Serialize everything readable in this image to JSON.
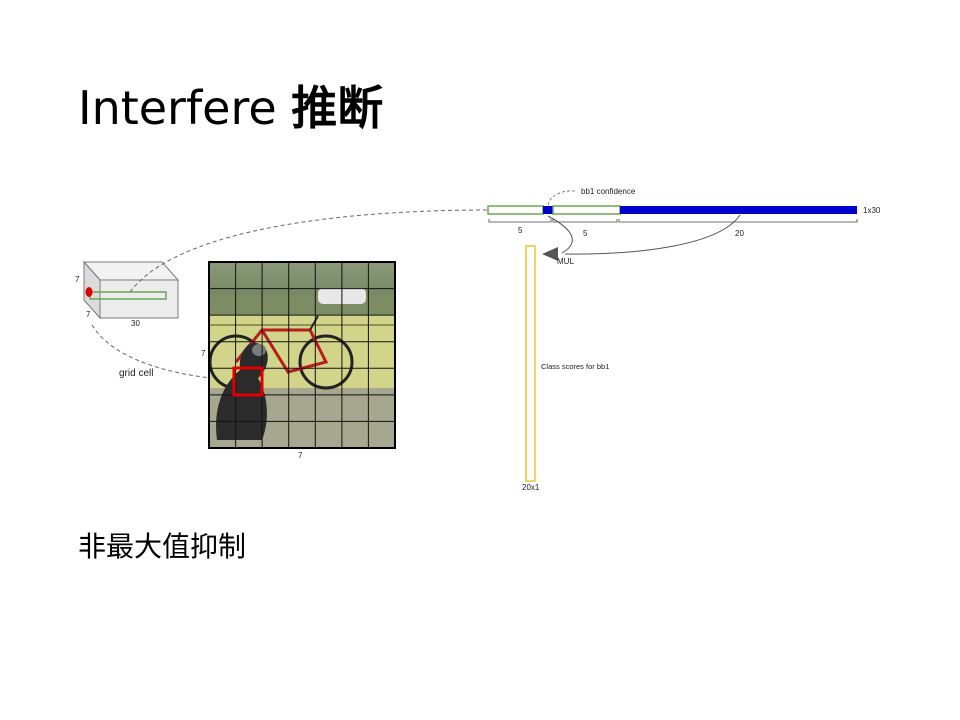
{
  "title": {
    "latin": "Interfere",
    "cjk": "推断"
  },
  "bullet": "非最大值抑制",
  "diagram": {
    "tensor_dims": {
      "height": "7",
      "width": "7",
      "depth": "30"
    },
    "grid_cell_label": "grid cell",
    "image_dims": {
      "side": "7",
      "bottom": "7"
    },
    "vector_label": "1x30",
    "segment_labels": {
      "box1": "5",
      "box2": "5",
      "classes": "20"
    },
    "confidence_label": "bb1 confidence",
    "mul_label": "MUL",
    "class_scores_label": "Class scores for bb1",
    "class_vector_label": "20x1",
    "colors": {
      "green": "#6aa84f",
      "blue": "#0000cc",
      "yellow": "#f1c232",
      "red": "#e00000"
    }
  }
}
